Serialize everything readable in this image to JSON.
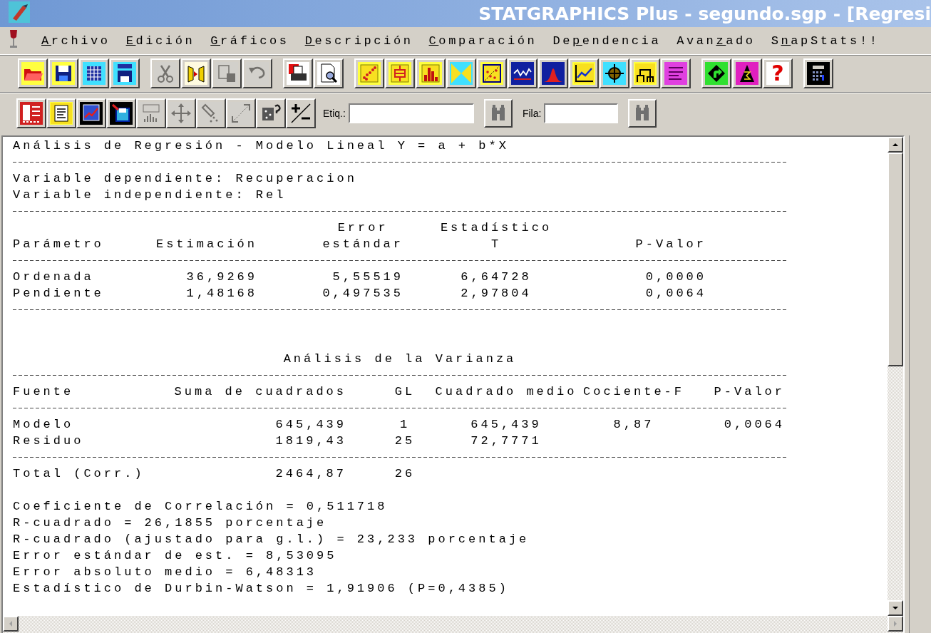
{
  "window": {
    "title": "STATGRAPHICS Plus - segundo.sgp - [Regresi"
  },
  "menu": [
    {
      "key": "A",
      "after": "rchivo"
    },
    {
      "key": "E",
      "after": "dición"
    },
    {
      "key": "G",
      "after": "ráficos"
    },
    {
      "key": "D",
      "after": "escripción"
    },
    {
      "key": "C",
      "after": "omparación"
    },
    {
      "before": "De",
      "key": "p",
      "after": "endencia"
    },
    {
      "before": "Avan",
      "key": "z",
      "after": "ado"
    },
    {
      "before": "S",
      "key": "n",
      "after": "apStats!!"
    }
  ],
  "toolbar": {
    "groups": [
      [
        {
          "kind": "open",
          "disabled": false
        },
        {
          "kind": "save",
          "disabled": false
        },
        {
          "kind": "datasheet",
          "disabled": false
        },
        {
          "kind": "save-data",
          "disabled": false
        }
      ],
      [
        {
          "kind": "cut",
          "disabled": true
        },
        {
          "kind": "panels",
          "disabled": false
        },
        {
          "kind": "paste",
          "disabled": true
        },
        {
          "kind": "undo",
          "disabled": true
        }
      ],
      [
        {
          "kind": "print",
          "disabled": false
        },
        {
          "kind": "preview",
          "disabled": false
        }
      ],
      [
        {
          "kind": "scatter",
          "disabled": false
        },
        {
          "kind": "boxplot",
          "disabled": false
        },
        {
          "kind": "histogram",
          "disabled": false
        },
        {
          "kind": "summary",
          "disabled": false
        },
        {
          "kind": "scatter-matrix",
          "disabled": false
        },
        {
          "kind": "timeseries",
          "disabled": false
        },
        {
          "kind": "bell",
          "disabled": false
        },
        {
          "kind": "trend",
          "disabled": false
        },
        {
          "kind": "target",
          "disabled": false
        },
        {
          "kind": "dendrogram",
          "disabled": false
        },
        {
          "kind": "glm",
          "disabled": false
        }
      ],
      [
        {
          "kind": "arrow",
          "disabled": false
        },
        {
          "kind": "wizard",
          "disabled": false
        },
        {
          "kind": "help",
          "glyph": "?",
          "disabled": false
        }
      ],
      [
        {
          "kind": "calculator",
          "disabled": false
        }
      ]
    ]
  },
  "output_toolbar": {
    "buttons": [
      {
        "kind": "options",
        "disabled": false
      },
      {
        "kind": "text-pane",
        "disabled": false
      },
      {
        "kind": "graph-pane",
        "disabled": false
      },
      {
        "kind": "save-results",
        "disabled": false
      },
      {
        "kind": "abc",
        "disabled": true
      },
      {
        "kind": "move",
        "disabled": true
      },
      {
        "kind": "brush",
        "disabled": true
      },
      {
        "kind": "zoom",
        "disabled": true
      },
      {
        "kind": "identify",
        "disabled": false
      },
      {
        "kind": "plusminus",
        "disabled": false
      }
    ],
    "searches": [
      {
        "label": "Etiq.:"
      },
      {
        "label": "Fila:"
      }
    ]
  },
  "report": {
    "title": "Análisis de Regresión - Modelo Lineal Y = a + b*X",
    "variables": [
      "Variable dependiente: Recuperacion",
      "Variable independiente: Rel"
    ],
    "parameters": {
      "columns": [
        {
          "lines": [
            "Parámetro"
          ]
        },
        {
          "lines": [
            "Estimación"
          ]
        },
        {
          "lines": [
            "Error",
            "estándar"
          ]
        },
        {
          "lines": [
            "Estadístico",
            "T"
          ]
        },
        {
          "lines": [
            "P-Valor"
          ]
        }
      ],
      "rows": [
        [
          "Ordenada",
          "36,9269",
          "5,55519",
          "6,64728",
          "0,0000"
        ],
        [
          "Pendiente",
          "1,48168",
          "0,497535",
          "2,97804",
          "0,0064"
        ]
      ]
    },
    "anova": {
      "title": "Análisis de la Varianza",
      "columns": [
        "Fuente",
        "Suma de cuadrados",
        "GL",
        "Cuadrado medio",
        "Cociente-F",
        "P-Valor"
      ],
      "rows": [
        [
          "Modelo",
          "645,439",
          "1",
          "645,439",
          "8,87",
          "0,0064"
        ],
        [
          "Residuo",
          "1819,43",
          "25",
          "72,7771"
        ]
      ],
      "total": [
        "Total (Corr.)",
        "2464,87",
        "26"
      ]
    },
    "statistics": [
      "Coeficiente de Correlación = 0,511718",
      "R-cuadrado = 26,1855 porcentaje",
      "R-cuadrado (ajustado para g.l.) = 23,233 porcentaje",
      "Error estándar de est. = 8,53095",
      "Error absoluto medio = 6,48313",
      "Estadístico de Durbin-Watson = 1,91906 (P=0,4385)"
    ]
  }
}
